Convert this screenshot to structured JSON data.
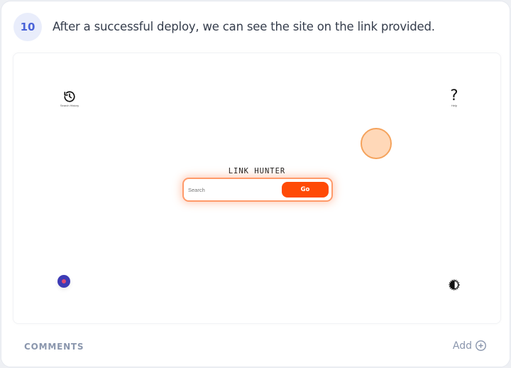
{
  "step": {
    "number": "10",
    "text": "After a successful deploy, we can see the site on the link provided."
  },
  "site": {
    "history_label": "Search History",
    "help_glyph": "?",
    "help_label": "Help",
    "brand": "LINK HUNTER",
    "search_placeholder": "Search",
    "go_label": "Go",
    "accent_color": "#ff4a06",
    "icons": [
      "history-icon",
      "help-icon",
      "theme-toggle-icon",
      "status-dot-icon"
    ]
  },
  "footer": {
    "comments_label": "COMMENTS",
    "add_label": "Add"
  }
}
